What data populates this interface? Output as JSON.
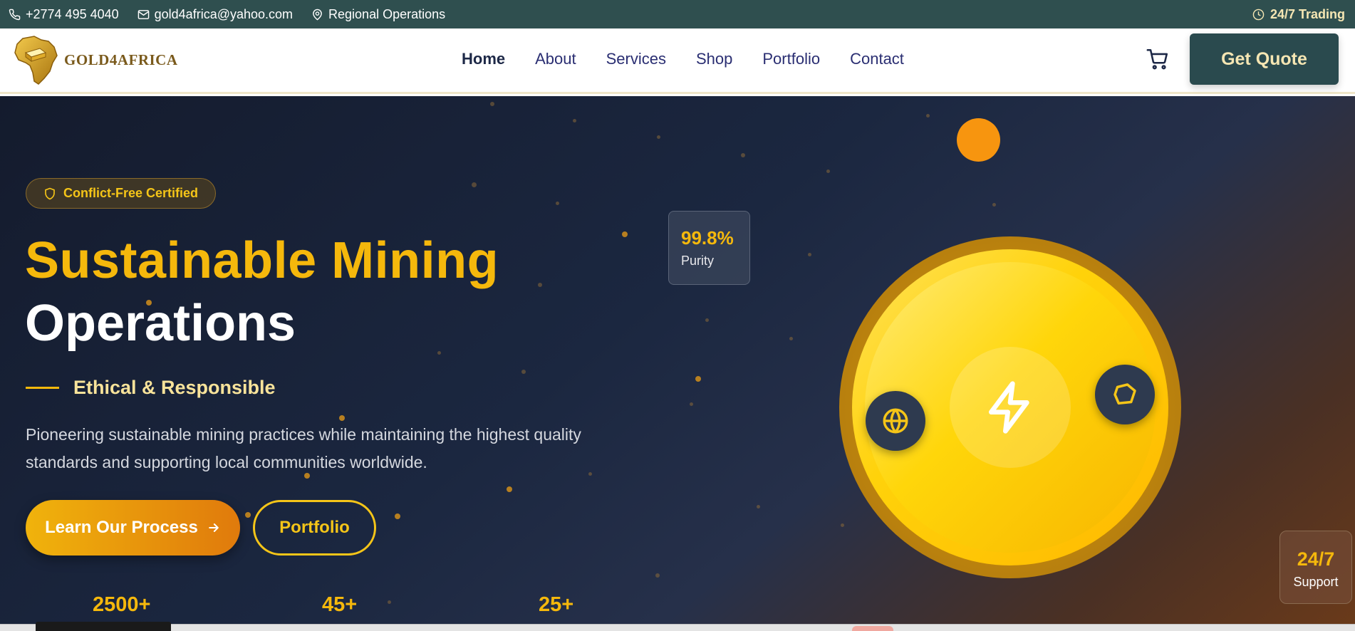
{
  "topbar": {
    "phone": "+2774 495 4040",
    "email": "gold4africa@yahoo.com",
    "location": "Regional Operations",
    "trading": "24/7 Trading"
  },
  "brand": {
    "name": "GOLD4AFRICA"
  },
  "nav": {
    "items": [
      {
        "label": "Home",
        "active": true
      },
      {
        "label": "About"
      },
      {
        "label": "Services"
      },
      {
        "label": "Shop"
      },
      {
        "label": "Portfolio"
      },
      {
        "label": "Contact"
      }
    ],
    "cta": "Get Quote"
  },
  "hero": {
    "badge": "Conflict-Free Certified",
    "title_line1": "Sustainable Mining",
    "title_line2": "Operations",
    "subtitle": "Ethical & Responsible",
    "description": "Pioneering sustainable mining practices while maintaining the highest quality standards and supporting local communities worldwide.",
    "primary_button": "Learn Our Process",
    "secondary_button": "Portfolio",
    "stats": [
      "2500+",
      "45+",
      "25+"
    ],
    "purity_card": {
      "value": "99.8%",
      "label": "Purity"
    },
    "support_card": {
      "value": "24/7",
      "label": "Support"
    }
  },
  "colors": {
    "topbar": "#2f4f4f",
    "accent_gold": "#f5b80c",
    "nav_text": "#2a2e72",
    "cta_bg": "#2a4a4e"
  },
  "icons": [
    "phone-icon",
    "mail-icon",
    "location-pin-icon",
    "clock-icon",
    "cart-icon",
    "shield-icon",
    "arrow-right-icon",
    "lightning-icon",
    "globe-icon",
    "gem-icon"
  ]
}
